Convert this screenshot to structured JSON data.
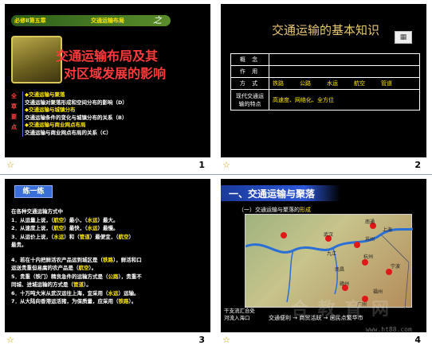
{
  "slides": [
    {
      "number": "1",
      "banner_tag1": "必修Ⅱ第五章",
      "banner_tag2": "交通运输布局",
      "banner_tag3": "之",
      "title_line1": "交通运输布局及其",
      "title_line2": "对区域发展的影响",
      "side_chars": [
        "全",
        "章",
        "要",
        "点"
      ],
      "items": [
        {
          "text": "◆交通运输与聚落",
          "highlight": true
        },
        {
          "text": "交通运输对聚落形成和空间分布的影响（D）",
          "highlight": false
        },
        {
          "text": "◆交通运输与城镇分布",
          "highlight": true
        },
        {
          "text": "交通运输条件的变化与城镇分布的关系（B）",
          "highlight": false
        },
        {
          "text": "◆交通运输与商业网点布局",
          "highlight": true
        },
        {
          "text": "交通运输与商业网点布局的关系（C）",
          "highlight": false
        }
      ]
    },
    {
      "number": "2",
      "title": "交通运输的基本知识",
      "rows": [
        {
          "key": "概 念",
          "value": ""
        },
        {
          "key": "作 用",
          "value": ""
        },
        {
          "key": "方 式",
          "modes": [
            "铁路",
            "公路",
            "水运",
            "航空",
            "管道"
          ]
        },
        {
          "key": "现代交通运输的特点",
          "value": "高速度、网络化、全方位"
        }
      ]
    },
    {
      "number": "3",
      "heading": "练一练",
      "intro": "在各种交通运输方式中",
      "lines": [
        [
          "1．从运量上说，（",
          "航空",
          "）最小，（",
          "水运",
          "）最大。"
        ],
        [
          "2．从速度上说，（",
          "航空",
          "）最快，（",
          "水运",
          "）最慢。"
        ],
        [
          "3．从运价上说，（",
          "水运",
          "）和（",
          "管道",
          "）最便宜，（",
          "航空",
          "）"
        ],
        [
          "最贵。"
        ],
        [
          ""
        ],
        [
          "4．若在十内把鲜活农产品运到城区是（",
          "铁路",
          "），鲜活和口"
        ],
        [
          "运送贵重但易腐的农产品是（",
          "航空",
          "）。"
        ],
        [
          "5．贵重（铁门）精良急件的运输方式是（",
          "公路",
          "），贵重不"
        ],
        [
          "同城、进城运输的方式是（",
          "管道",
          "）。"
        ],
        [
          "6．十万吨大米从武汉运往上海，宜采用（",
          "水运",
          "）运输。"
        ],
        [
          "7．从大陆向香港运活猪，为保质量，应采用（",
          "铁路",
          "）。"
        ]
      ]
    },
    {
      "number": "4",
      "heading": "一、交通运输与聚落",
      "sub_prefix": "（一）交通运输与聚落的",
      "sub_highlight": "形成",
      "map_labels": [
        "南通",
        "上海",
        "苏州",
        "杭州",
        "武汉",
        "九江",
        "南昌",
        "宁波",
        "福州",
        "赣州",
        "广州"
      ],
      "foot_line1": "干支流汇合处",
      "foot_line2": "河流入海口",
      "flow": "交通便利 → 商贸活跃 → 居民点繁华市",
      "watermark": "合 教 育 网",
      "url": "www.ht88.com"
    }
  ]
}
